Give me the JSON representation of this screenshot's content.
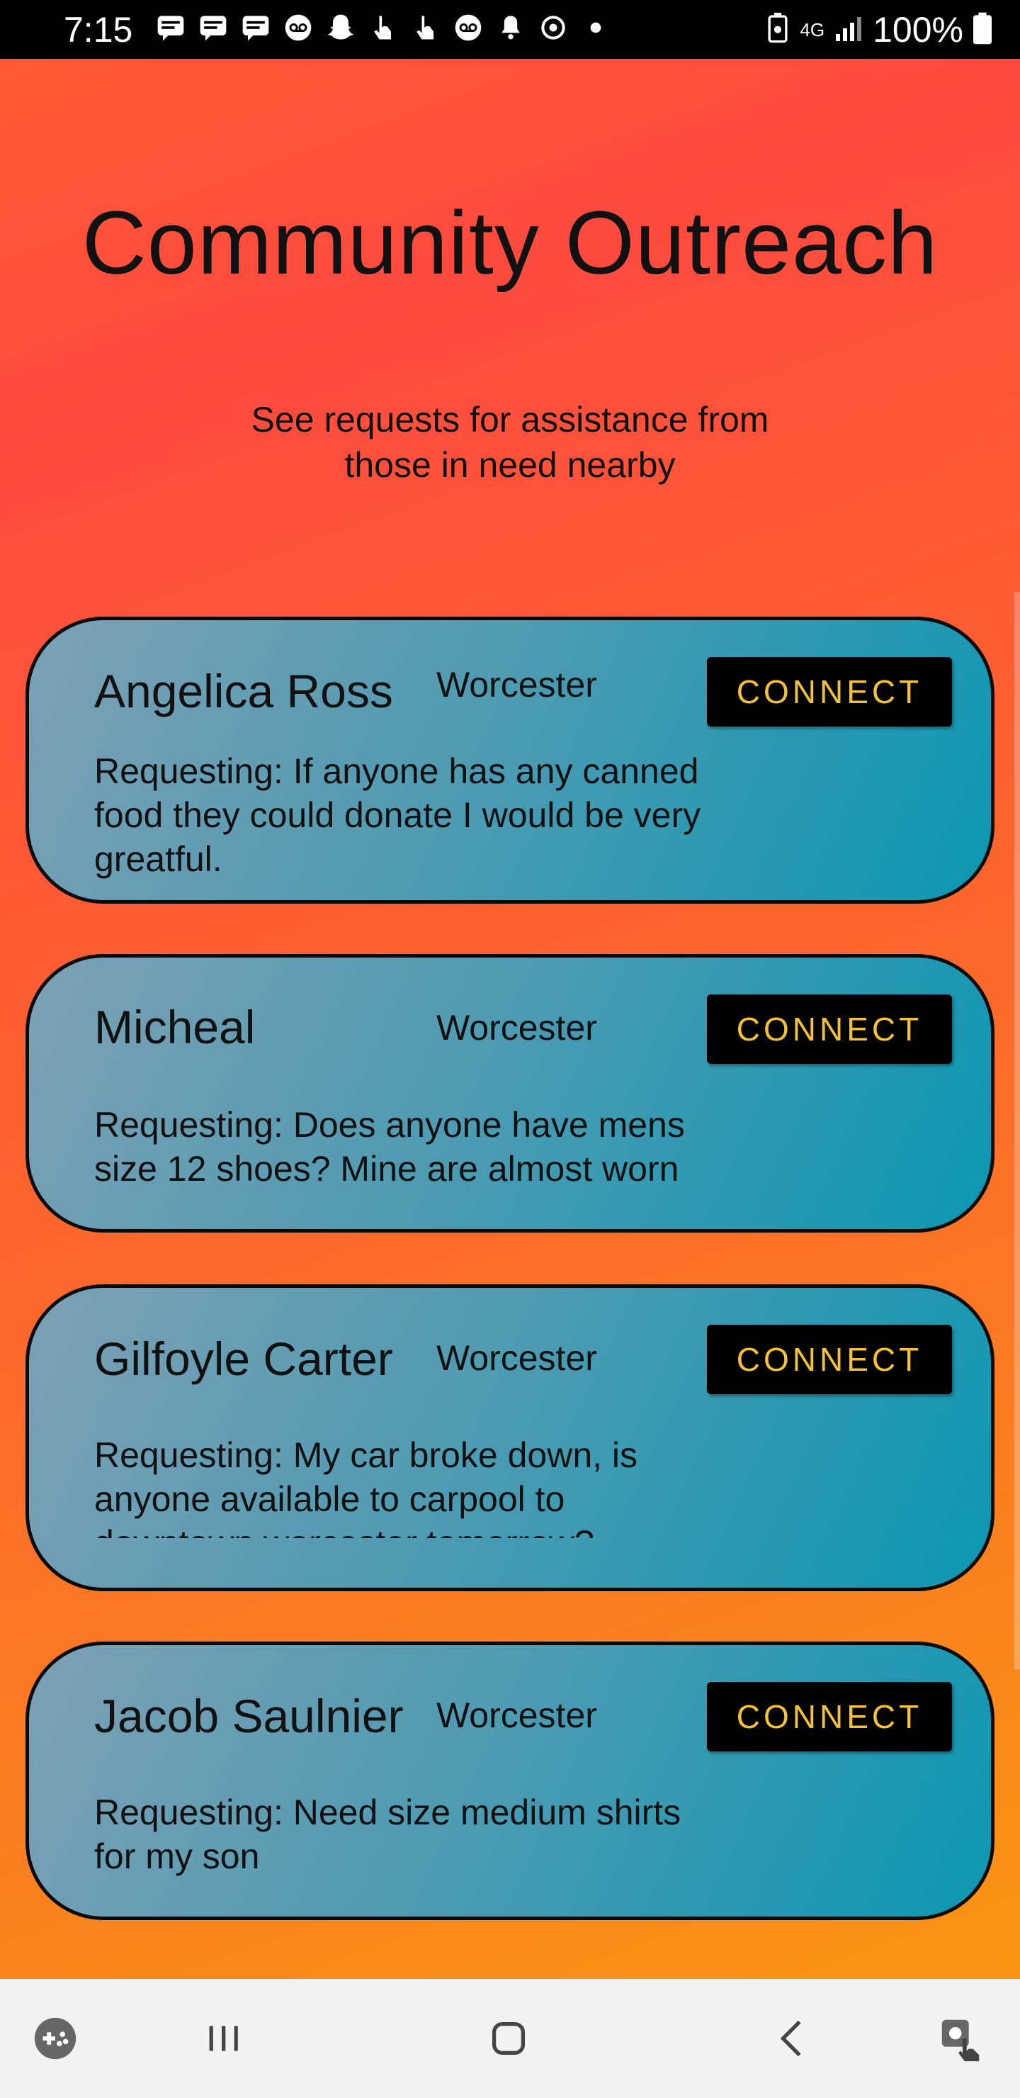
{
  "status_bar": {
    "time": "7:15",
    "notification_icons": [
      "message-icon",
      "message-icon",
      "message-icon",
      "voicemail-icon",
      "snapchat-icon",
      "touch-icon",
      "touch-icon",
      "voicemail-icon",
      "bell-icon",
      "sync-icon",
      "dot-icon"
    ],
    "network": "4G",
    "battery": "100%"
  },
  "header": {
    "title": "Community Outreach",
    "subtitle": "See requests for assistance from those in need nearby"
  },
  "requests": [
    {
      "name": "Angelica Ross",
      "location": "Worcester",
      "button": "CONNECT",
      "text": "Requesting: If anyone has any canned food they could donate I would be very greatful."
    },
    {
      "name": "Micheal",
      "location": "Worcester",
      "button": "CONNECT",
      "text": "Requesting: Does anyone have mens size 12 shoes? Mine are almost worn"
    },
    {
      "name": "Gilfoyle Carter",
      "location": "Worcester",
      "button": "CONNECT",
      "text": "Requesting: My car broke down, is anyone available to carpool to downtown worcester tomorrow?"
    },
    {
      "name": "Jacob Saulnier",
      "location": "Worcester",
      "button": "CONNECT",
      "text": "Requesting: Need size medium shirts for my son"
    }
  ],
  "nav_bar": {
    "items": [
      "game-launcher-icon",
      "recents-icon",
      "home-icon",
      "back-icon",
      "assistant-icon"
    ]
  },
  "colors": {
    "button_bg": "#000000",
    "button_text": "#f6c232",
    "card_gradient_start": "#7da0b5",
    "card_gradient_end": "#0c97b2"
  }
}
